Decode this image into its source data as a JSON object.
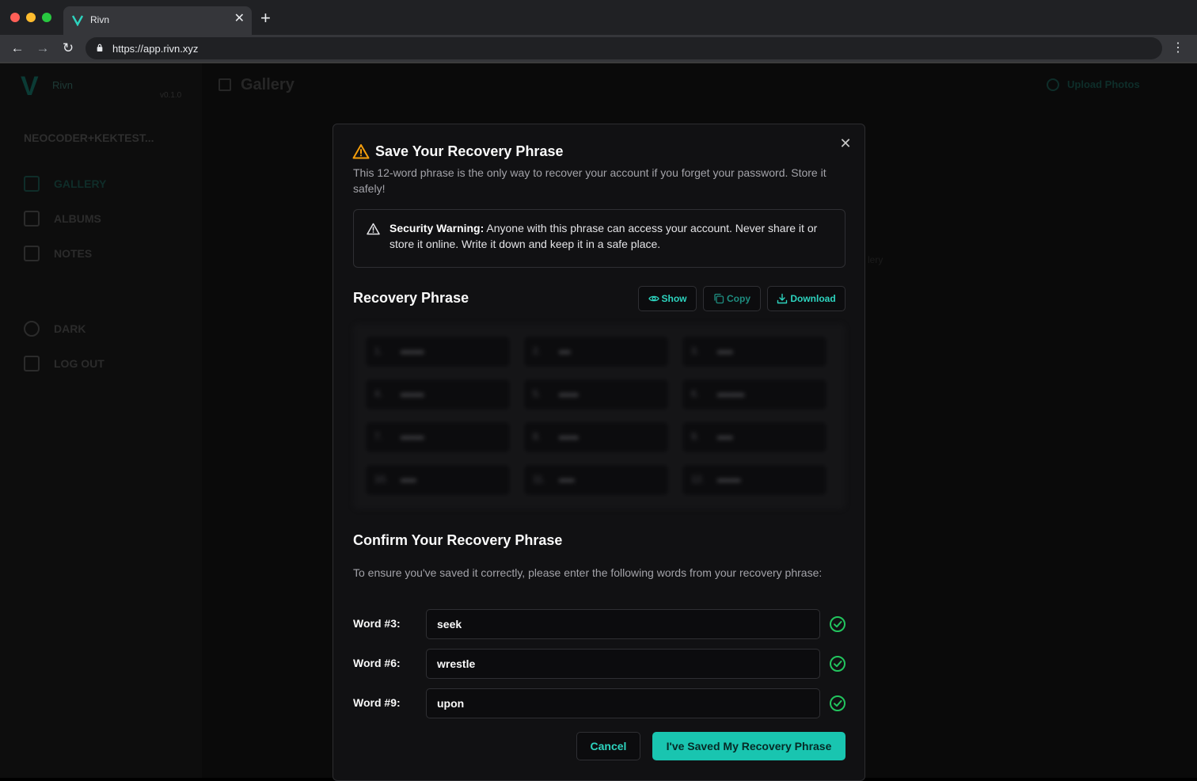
{
  "browser": {
    "tab_title": "Rivn",
    "url": "https://app.rivn.xyz",
    "new_tab_icon": "plus-icon"
  },
  "app": {
    "logo_letter": "V",
    "brand": "Rivn",
    "version": "v0.1.0",
    "user": "NEOCODER+KEKTEST...",
    "sidebar": {
      "items": [
        {
          "label": "GALLERY",
          "icon": "image-icon"
        },
        {
          "label": "ALBUMS",
          "icon": "folder-icon"
        },
        {
          "label": "NOTES",
          "icon": "file-icon"
        },
        {
          "label": "DARK",
          "icon": "moon-icon"
        },
        {
          "label": "LOG OUT",
          "icon": "logout-icon"
        }
      ]
    },
    "page_title": "Gallery",
    "upload_label": "Upload Photos",
    "stray_text": "lery"
  },
  "modal": {
    "title": "Save Your Recovery Phrase",
    "description": "This 12-word phrase is the only way to recover your account if you forget your password. Store it safely!",
    "warning": {
      "bold": "Security Warning:",
      "text": " Anyone with this phrase can access your account. Never share it or store it online. Write it down and keep it in a safe place."
    },
    "recovery_title": "Recovery Phrase",
    "buttons": {
      "show": "Show",
      "copy": "Copy",
      "download": "Download",
      "cancel": "Cancel",
      "confirm": "I've Saved My Recovery Phrase"
    },
    "phrase_words": [
      {
        "n": "1.",
        "w": "••••••"
      },
      {
        "n": "2.",
        "w": "•••"
      },
      {
        "n": "3.",
        "w": "••••"
      },
      {
        "n": "4.",
        "w": "••••••"
      },
      {
        "n": "5.",
        "w": "•••••"
      },
      {
        "n": "6.",
        "w": "•••••••"
      },
      {
        "n": "7.",
        "w": "••••••"
      },
      {
        "n": "8.",
        "w": "•••••"
      },
      {
        "n": "9.",
        "w": "••••"
      },
      {
        "n": "10.",
        "w": "••••"
      },
      {
        "n": "11.",
        "w": "••••"
      },
      {
        "n": "12.",
        "w": "••••••"
      }
    ],
    "confirm_title": "Confirm Your Recovery Phrase",
    "confirm_description": "To ensure you've saved it correctly, please enter the following words from your recovery phrase:",
    "confirm_fields": [
      {
        "label": "Word #3:",
        "value": "seek"
      },
      {
        "label": "Word #6:",
        "value": "wrestle"
      },
      {
        "label": "Word #9:",
        "value": "upon"
      }
    ],
    "colors": {
      "accent": "#19c5b0",
      "warning": "#f59e0b",
      "success": "#22c55e"
    }
  }
}
